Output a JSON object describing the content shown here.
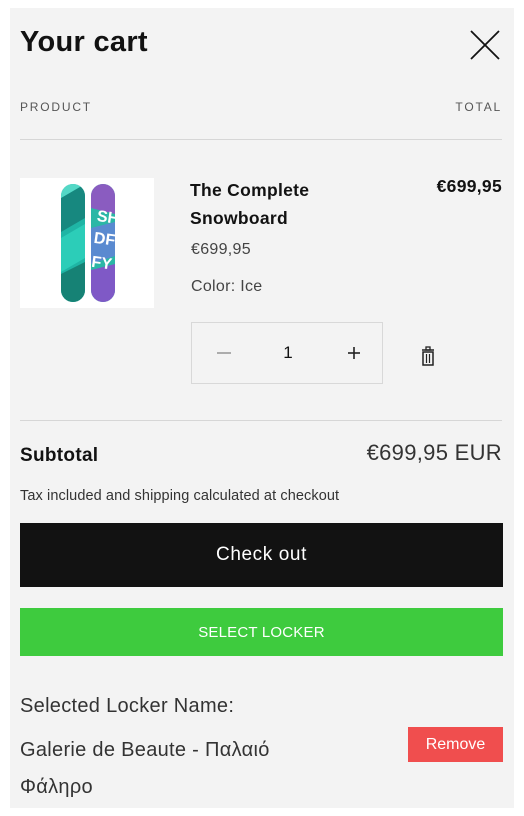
{
  "cart": {
    "title": "Your cart",
    "close_icon": "close-icon",
    "columns": {
      "product": "PRODUCT",
      "total": "TOTAL"
    },
    "items": [
      {
        "name": "The Complete Snowboard",
        "line_price": "€699,95",
        "unit_price": "€699,95",
        "variant": "Color: Ice",
        "quantity": "1",
        "image_icon": "snowboard-image",
        "decrease_icon": "minus-icon",
        "increase_icon": "plus-icon",
        "remove_icon": "trash-icon"
      }
    ],
    "subtotal": {
      "label": "Subtotal",
      "value": "€699,95 EUR"
    },
    "tax_note": "Tax included and shipping calculated at checkout",
    "checkout_label": "Check out"
  },
  "locker": {
    "select_label": "SELECT LOCKER",
    "selected_label": "Selected Locker Name:",
    "selected_name": "Galerie de Beaute - Παλαιό Φάληρο",
    "remove_label": "Remove"
  },
  "colors": {
    "checkout_bg": "#121212",
    "locker_button": "#3ecb3e",
    "remove_button": "#f04e4e",
    "drawer_bg": "#f3f3f3"
  }
}
